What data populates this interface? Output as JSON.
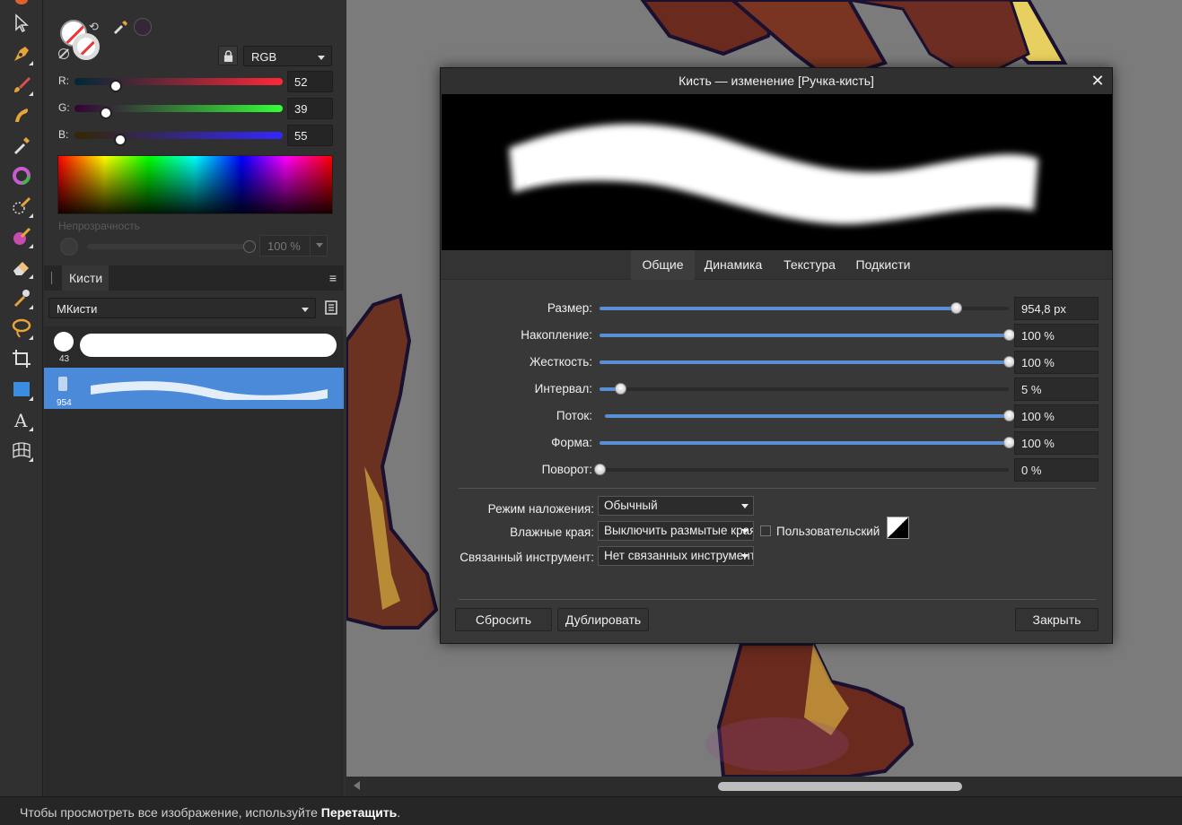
{
  "statusbar": {
    "prefix": "Чтобы просмотреть все изображение, используйте ",
    "bold": "Перетащить",
    "suffix": "."
  },
  "color": {
    "mode": "RGB",
    "r": {
      "label": "R:",
      "value": "52",
      "fraction": 0.2
    },
    "g": {
      "label": "G:",
      "value": "39",
      "fraction": 0.15
    },
    "b": {
      "label": "B:",
      "value": "55",
      "fraction": 0.22
    },
    "opacity_label": "Непрозрачность",
    "opacity_value": "100 %"
  },
  "brushes": {
    "tab_label": "Кисти",
    "category": "МКисти",
    "items": [
      {
        "size": "43"
      },
      {
        "size": "954"
      }
    ]
  },
  "dialog": {
    "title": "Кисть — изменение [Ручка-кисть]",
    "close": "✕",
    "tabs": [
      "Общие",
      "Динамика",
      "Текстура",
      "Подкисти"
    ],
    "params": [
      {
        "label": "Размер:",
        "value": "954,8 px",
        "fraction": 0.87
      },
      {
        "label": "Накопление:",
        "value": "100 %",
        "fraction": 1.0
      },
      {
        "label": "Жесткость:",
        "value": "100 %",
        "fraction": 1.0
      },
      {
        "label": "Интервал:",
        "value": "5 %",
        "fraction": 0.05
      },
      {
        "label": "Поток:",
        "value": "100 %",
        "fraction": 1.0
      },
      {
        "label": "Форма:",
        "value": "100 %",
        "fraction": 1.0
      },
      {
        "label": "Поворот:",
        "value": "0 %",
        "fraction": 0.0
      }
    ],
    "blend_label": "Режим наложения:",
    "blend_value": "Обычный",
    "wet_label": "Влажные края:",
    "wet_value": "Выключить размытые края",
    "custom_label": "Пользовательский",
    "linked_label": "Связанный инструмент:",
    "linked_value": "Нет связанных инструментов",
    "reset": "Сбросить",
    "duplicate": "Дублировать",
    "close_btn": "Закрыть"
  }
}
